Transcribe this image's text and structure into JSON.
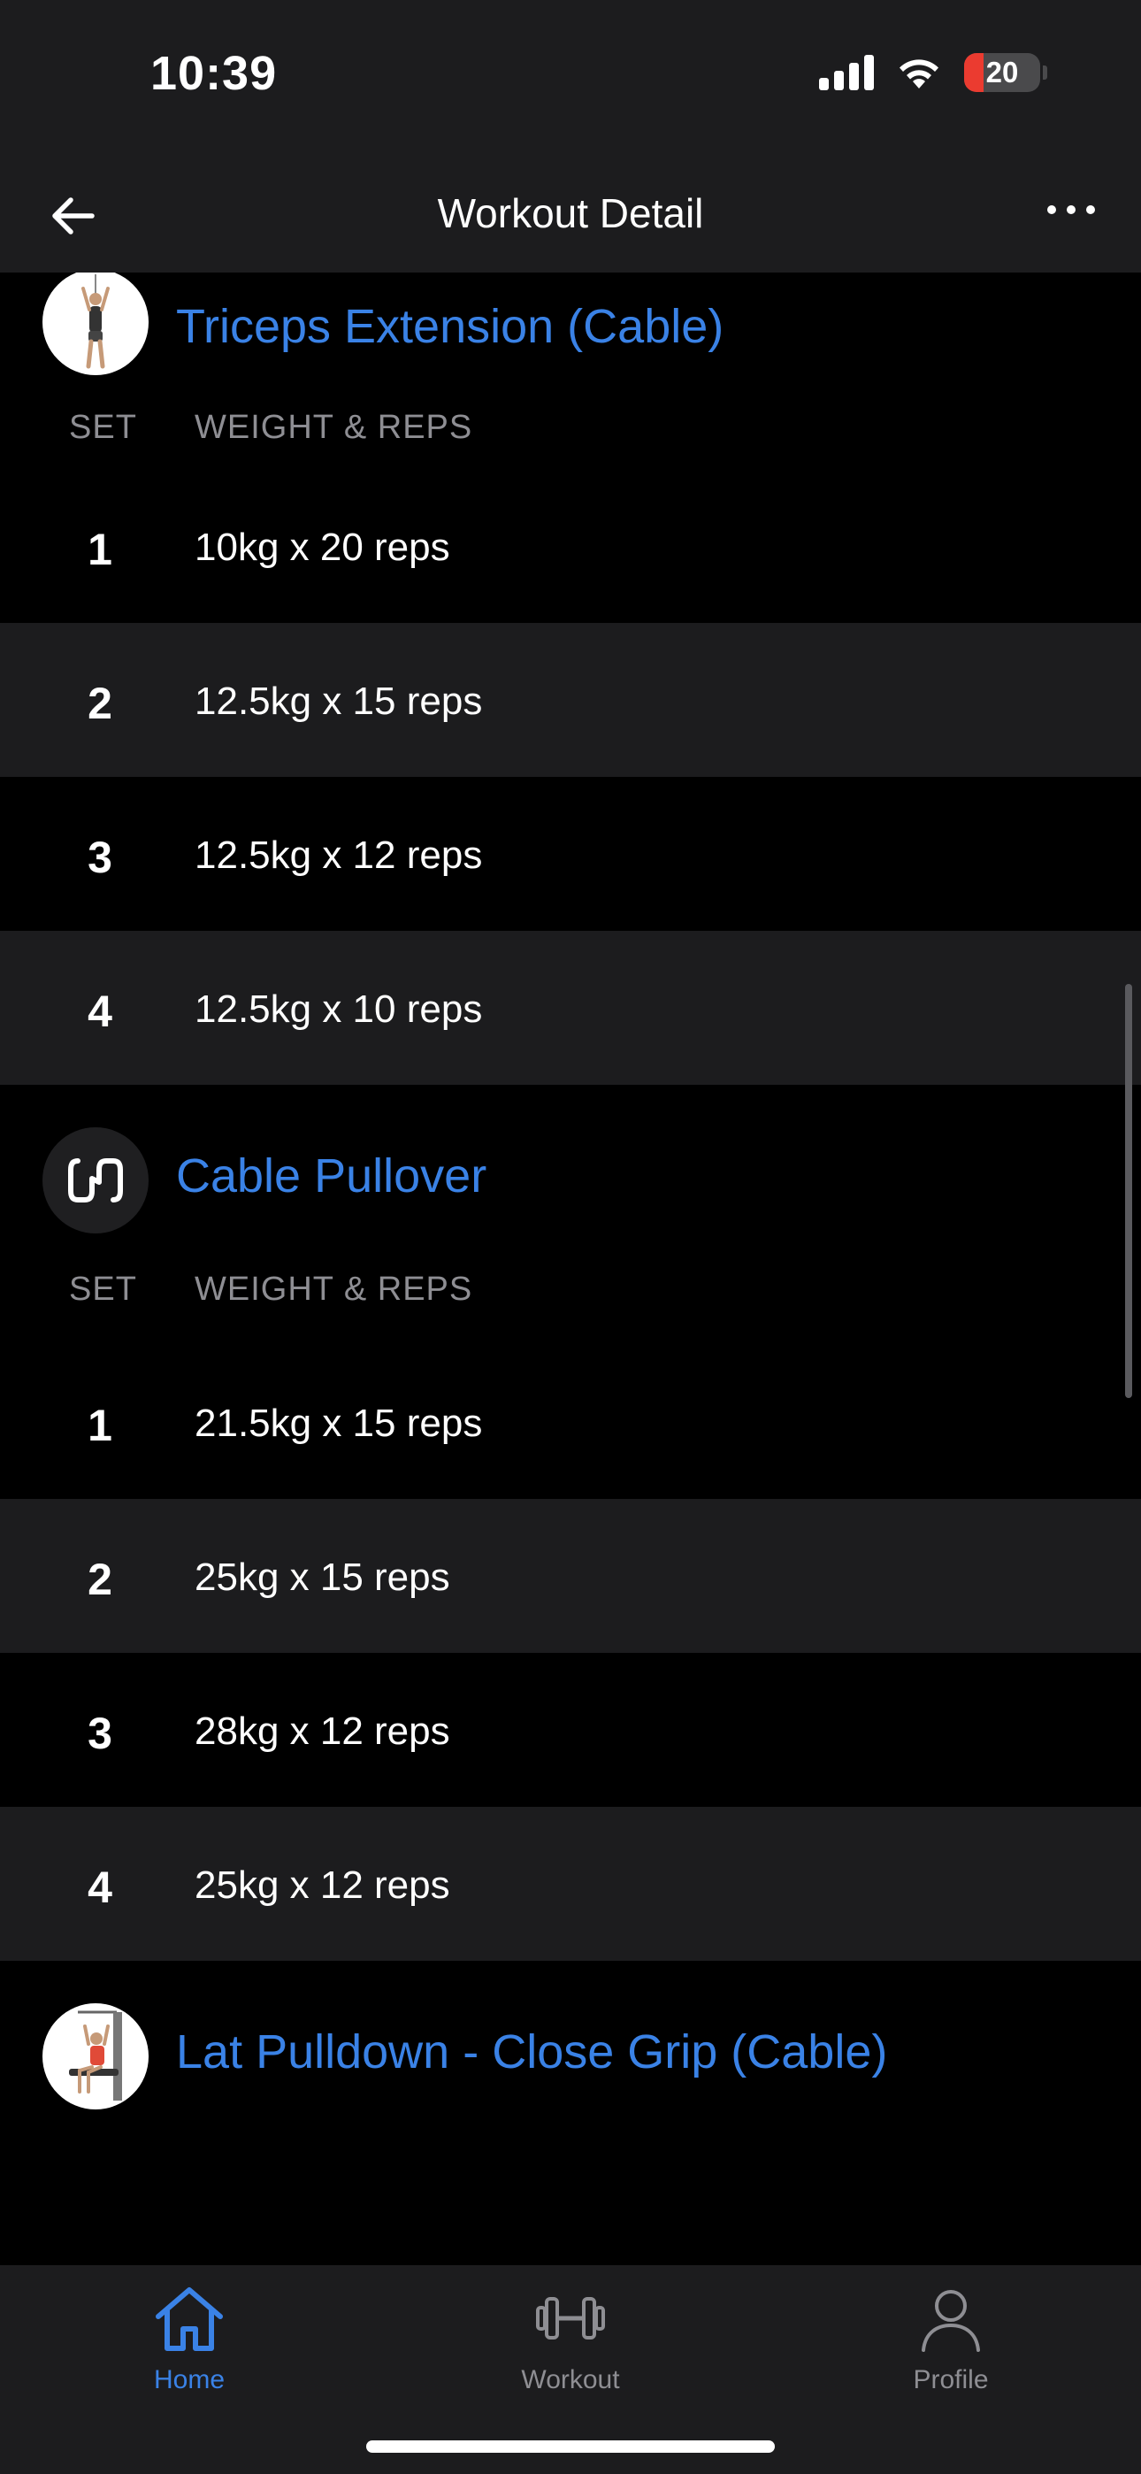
{
  "status_bar": {
    "time": "10:39",
    "battery": "20"
  },
  "header": {
    "title": "Workout Detail"
  },
  "columns": {
    "set": "SET",
    "weight_reps": "WEIGHT & REPS"
  },
  "exercises": [
    {
      "name": "Triceps Extension (Cable)",
      "icon": "triceps-extension-figure",
      "sets": [
        {
          "set": "1",
          "value": "10kg x 20 reps"
        },
        {
          "set": "2",
          "value": "12.5kg x 15 reps"
        },
        {
          "set": "3",
          "value": "12.5kg x 12 reps"
        },
        {
          "set": "4",
          "value": "12.5kg x 10 reps"
        }
      ]
    },
    {
      "name": "Cable Pullover",
      "icon": "cable-pullover-icon",
      "sets": [
        {
          "set": "1",
          "value": "21.5kg x 15 reps"
        },
        {
          "set": "2",
          "value": "25kg x 15 reps"
        },
        {
          "set": "3",
          "value": "28kg x 12 reps"
        },
        {
          "set": "4",
          "value": "25kg x 12 reps"
        }
      ]
    },
    {
      "name": "Lat Pulldown - Close Grip (Cable)",
      "icon": "lat-pulldown-figure",
      "sets": []
    }
  ],
  "tabs": [
    {
      "label": "Home",
      "icon": "home-icon",
      "active": true
    },
    {
      "label": "Workout",
      "icon": "dumbbell-icon",
      "active": false
    },
    {
      "label": "Profile",
      "icon": "profile-icon",
      "active": false
    }
  ],
  "colors": {
    "accent": "#3a82e6",
    "background": "#000000",
    "row_alt": "#1c1c1e",
    "muted": "#8e8e93",
    "battery_low": "#eb3b30"
  }
}
